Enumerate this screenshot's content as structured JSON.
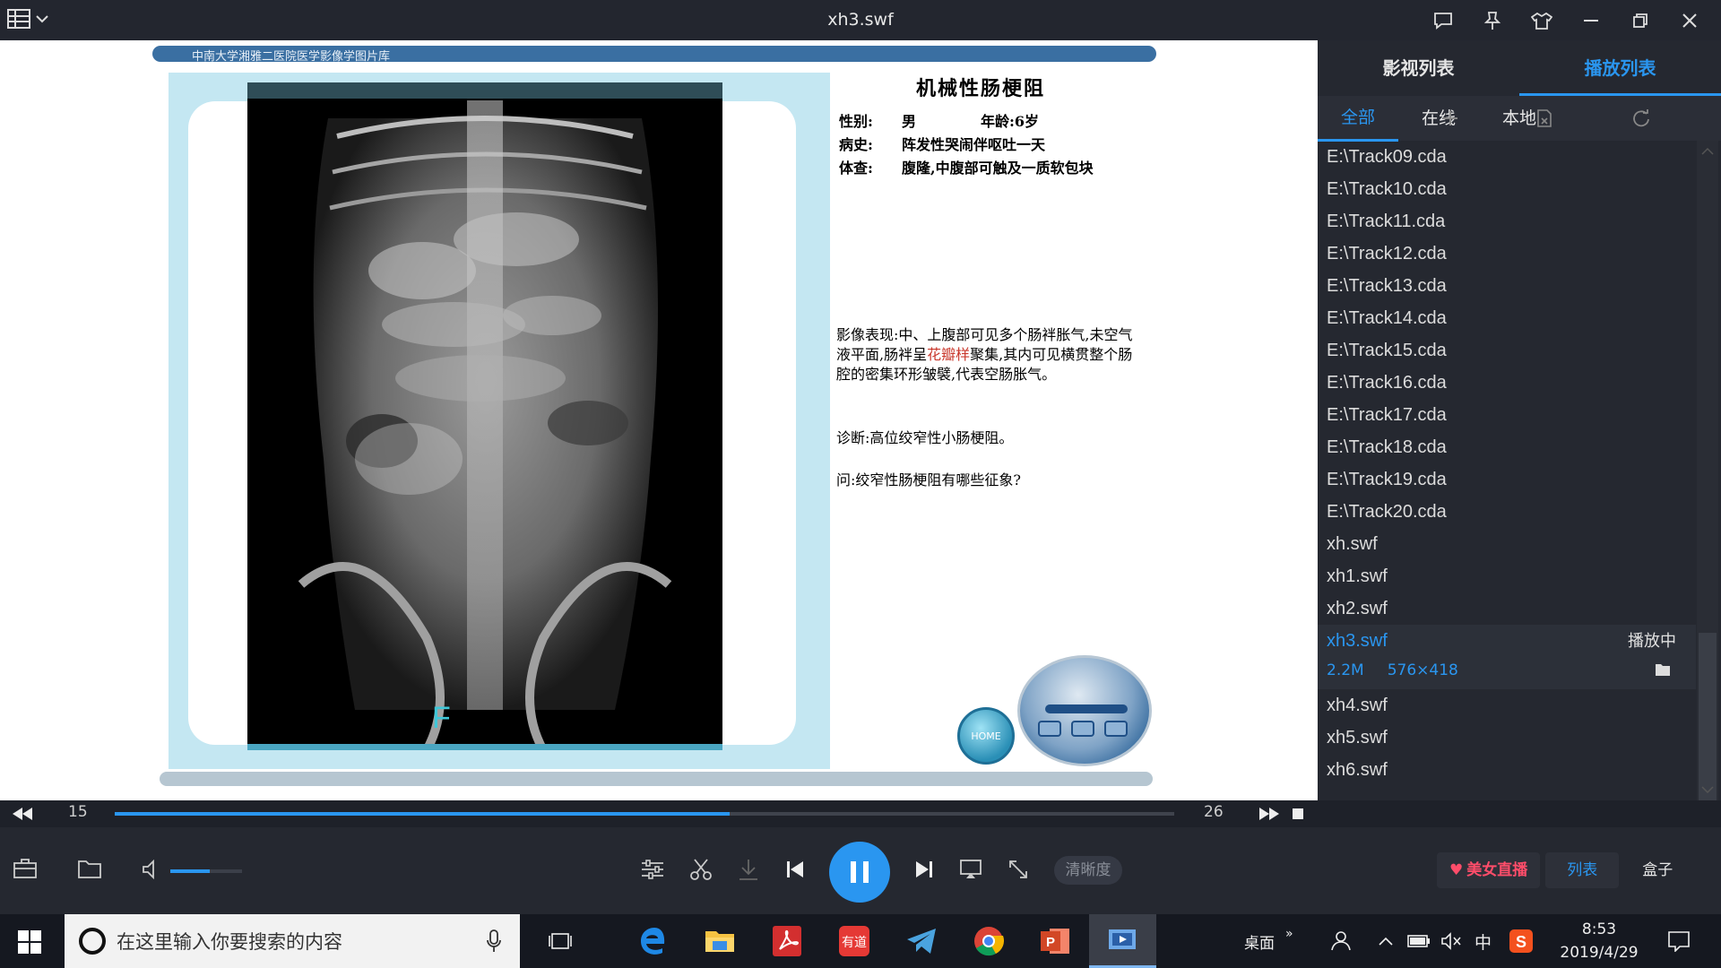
{
  "window": {
    "title": "xh3.swf"
  },
  "slide": {
    "banner": "中南大学湘雅二医院医学影像学图片库",
    "case_title": "机械性肠梗阻",
    "gender_label": "性别:",
    "gender": "男",
    "age": "年龄:6岁",
    "history_label": "病史:",
    "history": "阵发性哭闹伴呕吐一天",
    "exam_label": "体查:",
    "exam": "腹隆,中腹部可触及一质软包块",
    "findings_pre": "影像表现:中、上腹部可见多个肠袢胀气,未空气液平面,肠袢呈",
    "findings_red": "花瓣样",
    "findings_post": "聚集,其内可见横贯整个肠腔的密集环形皱襞,代表空肠胀气。",
    "diagnosis": "诊断:高位绞窄性小肠梗阻。",
    "question": "问:绞窄性肠梗阻有哪些征象?",
    "xray_marker": "F",
    "home_label": "HOME"
  },
  "panel": {
    "tabs": [
      "影视列表",
      "播放列表"
    ],
    "subtabs": [
      "全部",
      "在线",
      "本地"
    ],
    "items_before": [
      "E:\\Track09.cda",
      "E:\\Track10.cda",
      "E:\\Track11.cda",
      "E:\\Track12.cda",
      "E:\\Track13.cda",
      "E:\\Track14.cda",
      "E:\\Track15.cda",
      "E:\\Track16.cda",
      "E:\\Track17.cda",
      "E:\\Track18.cda",
      "E:\\Track19.cda",
      "E:\\Track20.cda",
      "xh.swf",
      "xh1.swf",
      "xh2.swf"
    ],
    "current": {
      "name": "xh3.swf",
      "status": "播放中",
      "size": "2.2M",
      "resolution": "576×418"
    },
    "items_after": [
      "xh4.swf",
      "xh5.swf",
      "xh6.swf"
    ]
  },
  "playback": {
    "current_frame": "15",
    "total_frames": "26",
    "progress": 0.58,
    "volume": 0.55
  },
  "controls": {
    "quality": "清晰度",
    "live_label": "美女直播",
    "list_label": "列表",
    "box_label": "盒子"
  },
  "taskbar": {
    "search_placeholder": "在这里输入你要搜索的内容",
    "desktop_label": "桌面",
    "ime": "中",
    "time": "8:53",
    "date": "2019/4/29"
  },
  "colors": {
    "accent": "#2a96f0",
    "highlight_text": "#c9382c"
  }
}
